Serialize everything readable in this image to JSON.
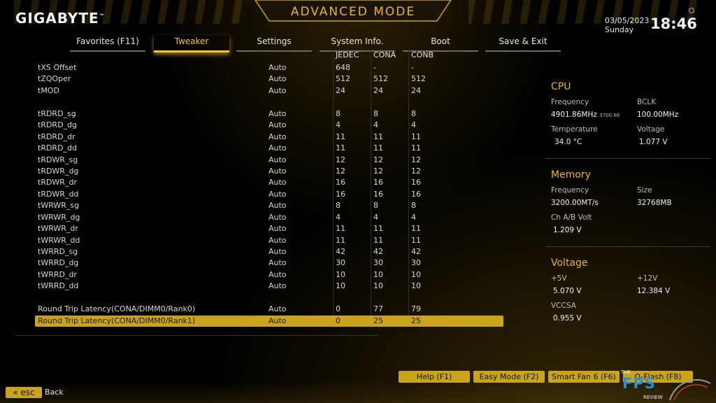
{
  "header": {
    "brand": "GIGABYTE",
    "brand_tm": "™",
    "mode_title": "ADVANCED MODE",
    "date": "03/05/2023",
    "day": "Sunday",
    "time": "18:46"
  },
  "tabs": [
    {
      "label": "Favorites (F11)",
      "active": false
    },
    {
      "label": "Tweaker",
      "active": true
    },
    {
      "label": "Settings",
      "active": false
    },
    {
      "label": "System Info.",
      "active": false
    },
    {
      "label": "Boot",
      "active": false
    },
    {
      "label": "Save & Exit",
      "active": false
    }
  ],
  "columns": {
    "jedec": "JEDEC",
    "cona": "CONA",
    "conb": "CONB"
  },
  "rows": [
    {
      "name": "tXS Offset",
      "value": "Auto",
      "jedec": "648",
      "cona": "-",
      "conb": "-"
    },
    {
      "name": "tZQOper",
      "value": "Auto",
      "jedec": "512",
      "cona": "512",
      "conb": "512"
    },
    {
      "name": "tMOD",
      "value": "Auto",
      "jedec": "24",
      "cona": "24",
      "conb": "24"
    },
    {
      "name": "tRDRD_sg",
      "value": "Auto",
      "jedec": "8",
      "cona": "8",
      "conb": "8"
    },
    {
      "name": "tRDRD_dg",
      "value": "Auto",
      "jedec": "4",
      "cona": "4",
      "conb": "4"
    },
    {
      "name": "tRDRD_dr",
      "value": "Auto",
      "jedec": "11",
      "cona": "11",
      "conb": "11"
    },
    {
      "name": "tRDRD_dd",
      "value": "Auto",
      "jedec": "11",
      "cona": "11",
      "conb": "11"
    },
    {
      "name": "tRDWR_sg",
      "value": "Auto",
      "jedec": "12",
      "cona": "12",
      "conb": "12"
    },
    {
      "name": "tRDWR_dg",
      "value": "Auto",
      "jedec": "12",
      "cona": "12",
      "conb": "12"
    },
    {
      "name": "tRDWR_dr",
      "value": "Auto",
      "jedec": "16",
      "cona": "16",
      "conb": "16"
    },
    {
      "name": "tRDWR_dd",
      "value": "Auto",
      "jedec": "16",
      "cona": "16",
      "conb": "16"
    },
    {
      "name": "tWRWR_sg",
      "value": "Auto",
      "jedec": "8",
      "cona": "8",
      "conb": "8"
    },
    {
      "name": "tWRWR_dg",
      "value": "Auto",
      "jedec": "4",
      "cona": "4",
      "conb": "4"
    },
    {
      "name": "tWRWR_dr",
      "value": "Auto",
      "jedec": "11",
      "cona": "11",
      "conb": "11"
    },
    {
      "name": "tWRWR_dd",
      "value": "Auto",
      "jedec": "11",
      "cona": "11",
      "conb": "11"
    },
    {
      "name": "tWRRD_sg",
      "value": "Auto",
      "jedec": "42",
      "cona": "42",
      "conb": "42"
    },
    {
      "name": "tWRRD_dg",
      "value": "Auto",
      "jedec": "30",
      "cona": "30",
      "conb": "30"
    },
    {
      "name": "tWRRD_dr",
      "value": "Auto",
      "jedec": "10",
      "cona": "10",
      "conb": "10"
    },
    {
      "name": "tWRRD_dd",
      "value": "Auto",
      "jedec": "10",
      "cona": "10",
      "conb": "10"
    },
    {
      "name": "Round Trip Latency(CONA/DIMM0/Rank0)",
      "value": "Auto",
      "jedec": "0",
      "cona": "77",
      "conb": "79"
    },
    {
      "name": "Round Trip Latency(CONA/DIMM0/Rank1)",
      "value": "Auto",
      "jedec": "0",
      "cona": "25",
      "conb": "25"
    }
  ],
  "info": {
    "cpu": {
      "title": "CPU",
      "frequency_label": "Frequency",
      "frequency": "4901.86MHz",
      "frequency_sub": "3700.66",
      "bclk_label": "BCLK",
      "bclk": "100.00MHz",
      "temperature_label": "Temperature",
      "temperature": "34.0 °C",
      "voltage_label": "Voltage",
      "voltage": "1.077 V"
    },
    "memory": {
      "title": "Memory",
      "frequency_label": "Frequency",
      "frequency": "3200.00MT/s",
      "size_label": "Size",
      "size": "32768MB",
      "volt_label": "Ch A/B Volt",
      "volt": "1.209 V"
    },
    "voltage": {
      "title": "Voltage",
      "p5_label": "+5V",
      "p5": "5.070 V",
      "p12_label": "+12V",
      "p12": "12.384 V",
      "vccsa_label": "VCCSA",
      "vccsa": "0.955 V"
    }
  },
  "footer": {
    "help": "Help (F1)",
    "easy": "Easy Mode (F2)",
    "smartfan": "Smart Fan 6 (F6)",
    "qflash": "Q-Flash (F8)",
    "esc": "esc",
    "esc_glyph": "«",
    "back": "Back",
    "watermark_the": "THE",
    "watermark_main": "FPS",
    "watermark_review": "REVIEW"
  },
  "colors": {
    "accent": "#e9b52a",
    "selected_row": "#c9a41a",
    "watermark": "#2f8cd6"
  }
}
